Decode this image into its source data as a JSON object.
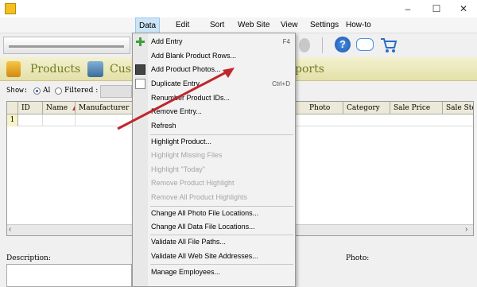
{
  "window": {
    "controls": {
      "minimize": "–",
      "maximize": "☐",
      "close": "✕"
    }
  },
  "menubar": {
    "items": [
      "Data",
      "Edit",
      "Sort",
      "Web Site",
      "View",
      "Settings",
      "How-to"
    ]
  },
  "tabs": {
    "products": "Products",
    "customers": "Cus",
    "reports": "ports"
  },
  "show": {
    "label": "Show:",
    "all": "Al",
    "filtered": "Filtered :"
  },
  "grid": {
    "columns": [
      "ID",
      "Name",
      "Manufacturer",
      "Photo",
      "Category",
      "Sale Price",
      "Sale Sto"
    ],
    "first_row_number": "1"
  },
  "description_label": "Description:",
  "photo_label": "Photo:",
  "dropdown": {
    "items": [
      {
        "label": "Add Entry",
        "shortcut": "F4",
        "disabled": false
      },
      {
        "label": "Add Blank Product Rows...",
        "shortcut": "",
        "disabled": false
      },
      {
        "label": "Add Product Photos...",
        "shortcut": "",
        "disabled": false
      },
      {
        "label": "Duplicate Entry",
        "shortcut": "Ctrl+D",
        "disabled": false
      },
      {
        "label": "Renumber Product IDs...",
        "shortcut": "",
        "disabled": false
      },
      {
        "label": "Remove Entry...",
        "shortcut": "",
        "disabled": false
      },
      {
        "label": "Refresh",
        "shortcut": "",
        "disabled": false
      },
      {
        "label": "Highlight Product...",
        "shortcut": "",
        "disabled": false
      },
      {
        "label": "Highlight Missing Files",
        "shortcut": "",
        "disabled": true
      },
      {
        "label": "Highlight \"Today\"",
        "shortcut": "",
        "disabled": true
      },
      {
        "label": "Remove Product Highlight",
        "shortcut": "",
        "disabled": true
      },
      {
        "label": "Remove All Product Highlights",
        "shortcut": "",
        "disabled": true
      },
      {
        "label": "Change All Photo File Locations...",
        "shortcut": "",
        "disabled": false
      },
      {
        "label": "Change All Data File Locations...",
        "shortcut": "",
        "disabled": false
      },
      {
        "label": "Validate All File Paths...",
        "shortcut": "",
        "disabled": false
      },
      {
        "label": "Validate All Web Site Addresses...",
        "shortcut": "",
        "disabled": false
      },
      {
        "label": "Manage Employees...",
        "shortcut": "",
        "disabled": false
      }
    ]
  },
  "colors": {
    "tab_text": "#6e7b24",
    "menu_highlight": "#cce4f7",
    "arrow": "#c0262d",
    "disabled_text": "#a5a5a5"
  }
}
